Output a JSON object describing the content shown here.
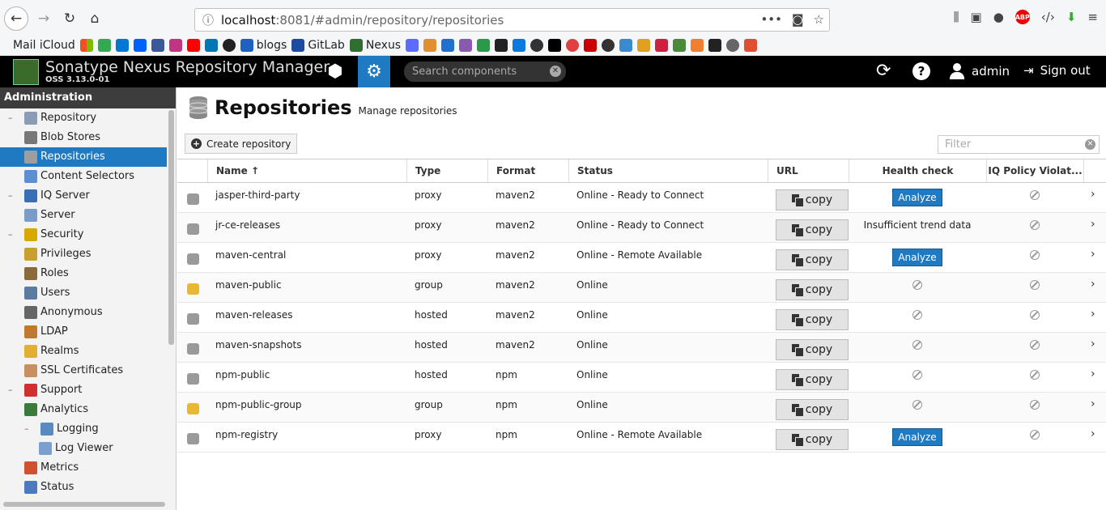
{
  "browser": {
    "url_host": "localhost",
    "url_path": ":8081/#admin/repository/repositories",
    "bookmarks": [
      "Mail iCloud",
      "blogs",
      "GitLab",
      "Nexus"
    ]
  },
  "header": {
    "title": "Sonatype Nexus Repository Manager",
    "version": "OSS 3.13.0-01",
    "search_placeholder": "Search components",
    "user": "admin",
    "signout": "Sign out"
  },
  "sidebar": {
    "title": "Administration",
    "items": [
      {
        "label": "Repository",
        "level": 0,
        "twisty": "–",
        "color": "#8a9cb5"
      },
      {
        "label": "Blob Stores",
        "level": 1,
        "twisty": "",
        "color": "#777777"
      },
      {
        "label": "Repositories",
        "level": 1,
        "twisty": "",
        "color": "#9e9e9e",
        "selected": true
      },
      {
        "label": "Content Selectors",
        "level": 1,
        "twisty": "",
        "color": "#5b8fd0"
      },
      {
        "label": "IQ Server",
        "level": 0,
        "twisty": "–",
        "color": "#3b6fb5"
      },
      {
        "label": "Server",
        "level": 1,
        "twisty": "",
        "color": "#7a9cc8"
      },
      {
        "label": "Security",
        "level": 0,
        "twisty": "–",
        "color": "#d6a800"
      },
      {
        "label": "Privileges",
        "level": 1,
        "twisty": "",
        "color": "#c8a030"
      },
      {
        "label": "Roles",
        "level": 1,
        "twisty": "",
        "color": "#8a6a3a"
      },
      {
        "label": "Users",
        "level": 1,
        "twisty": "",
        "color": "#5a7aa0"
      },
      {
        "label": "Anonymous",
        "level": 1,
        "twisty": "",
        "color": "#666666"
      },
      {
        "label": "LDAP",
        "level": 1,
        "twisty": "",
        "color": "#c07a30"
      },
      {
        "label": "Realms",
        "level": 1,
        "twisty": "",
        "color": "#e0b030"
      },
      {
        "label": "SSL Certificates",
        "level": 1,
        "twisty": "",
        "color": "#c89060"
      },
      {
        "label": "Support",
        "level": 0,
        "twisty": "–",
        "color": "#d03030"
      },
      {
        "label": "Analytics",
        "level": 1,
        "twisty": "",
        "color": "#3a7a3a"
      },
      {
        "label": "Logging",
        "level": 1,
        "twisty": "–",
        "color": "#5a8ac0"
      },
      {
        "label": "Log Viewer",
        "level": 2,
        "twisty": "",
        "color": "#7aa0d0"
      },
      {
        "label": "Metrics",
        "level": 1,
        "twisty": "",
        "color": "#d05030"
      },
      {
        "label": "Status",
        "level": 1,
        "twisty": "",
        "color": "#4a7ac0"
      }
    ]
  },
  "page": {
    "title": "Repositories",
    "subtitle": "Manage repositories",
    "create_label": "Create repository",
    "filter_placeholder": "Filter"
  },
  "table": {
    "columns": [
      "Name ↑",
      "Type",
      "Format",
      "Status",
      "URL",
      "Health check",
      "IQ Policy Violat..."
    ],
    "copy_label": "copy",
    "analyze_label": "Analyze",
    "rows": [
      {
        "name": "jasper-third-party",
        "type": "proxy",
        "format": "maven2",
        "status": "Online - Ready to Connect",
        "health": "analyze"
      },
      {
        "name": "jr-ce-releases",
        "type": "proxy",
        "format": "maven2",
        "status": "Online - Ready to Connect",
        "health": "Insufficient trend data"
      },
      {
        "name": "maven-central",
        "type": "proxy",
        "format": "maven2",
        "status": "Online - Remote Available",
        "health": "analyze"
      },
      {
        "name": "maven-public",
        "type": "group",
        "format": "maven2",
        "status": "Online",
        "health": "none"
      },
      {
        "name": "maven-releases",
        "type": "hosted",
        "format": "maven2",
        "status": "Online",
        "health": "none"
      },
      {
        "name": "maven-snapshots",
        "type": "hosted",
        "format": "maven2",
        "status": "Online",
        "health": "none"
      },
      {
        "name": "npm-public",
        "type": "hosted",
        "format": "npm",
        "status": "Online",
        "health": "none"
      },
      {
        "name": "npm-public-group",
        "type": "group",
        "format": "npm",
        "status": "Online",
        "health": "none"
      },
      {
        "name": "npm-registry",
        "type": "proxy",
        "format": "npm",
        "status": "Online - Remote Available",
        "health": "analyze"
      }
    ]
  }
}
